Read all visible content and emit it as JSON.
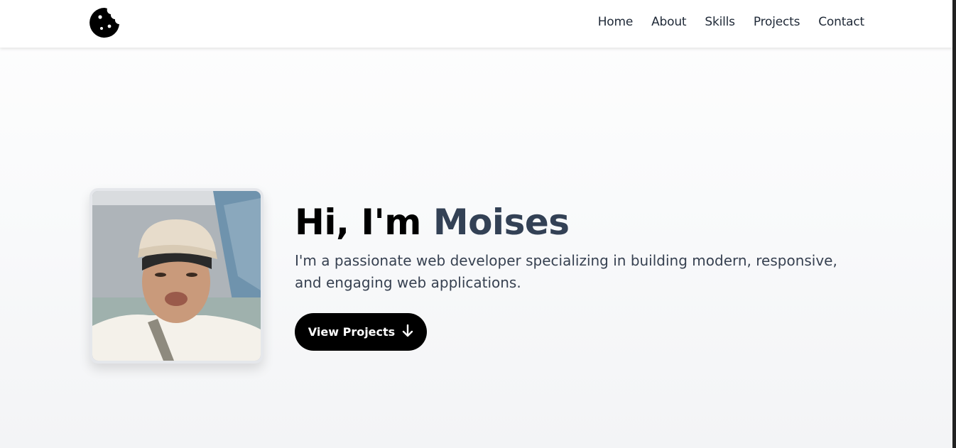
{
  "nav": {
    "logo_icon": "cookie-icon",
    "links": [
      "Home",
      "About",
      "Skills",
      "Projects",
      "Contact"
    ]
  },
  "hero": {
    "greeting": "Hi, I'm",
    "name": "Moises",
    "tagline": "I'm a passionate web developer specializing in building modern, responsive, and engaging web applications.",
    "cta_label": "View Projects",
    "cta_icon": "arrow-down-icon",
    "photo": "profile-photo"
  },
  "colors": {
    "text_dark": "#000000",
    "name_accent": "#334155",
    "button_bg": "#000000",
    "button_text": "#ffffff"
  }
}
